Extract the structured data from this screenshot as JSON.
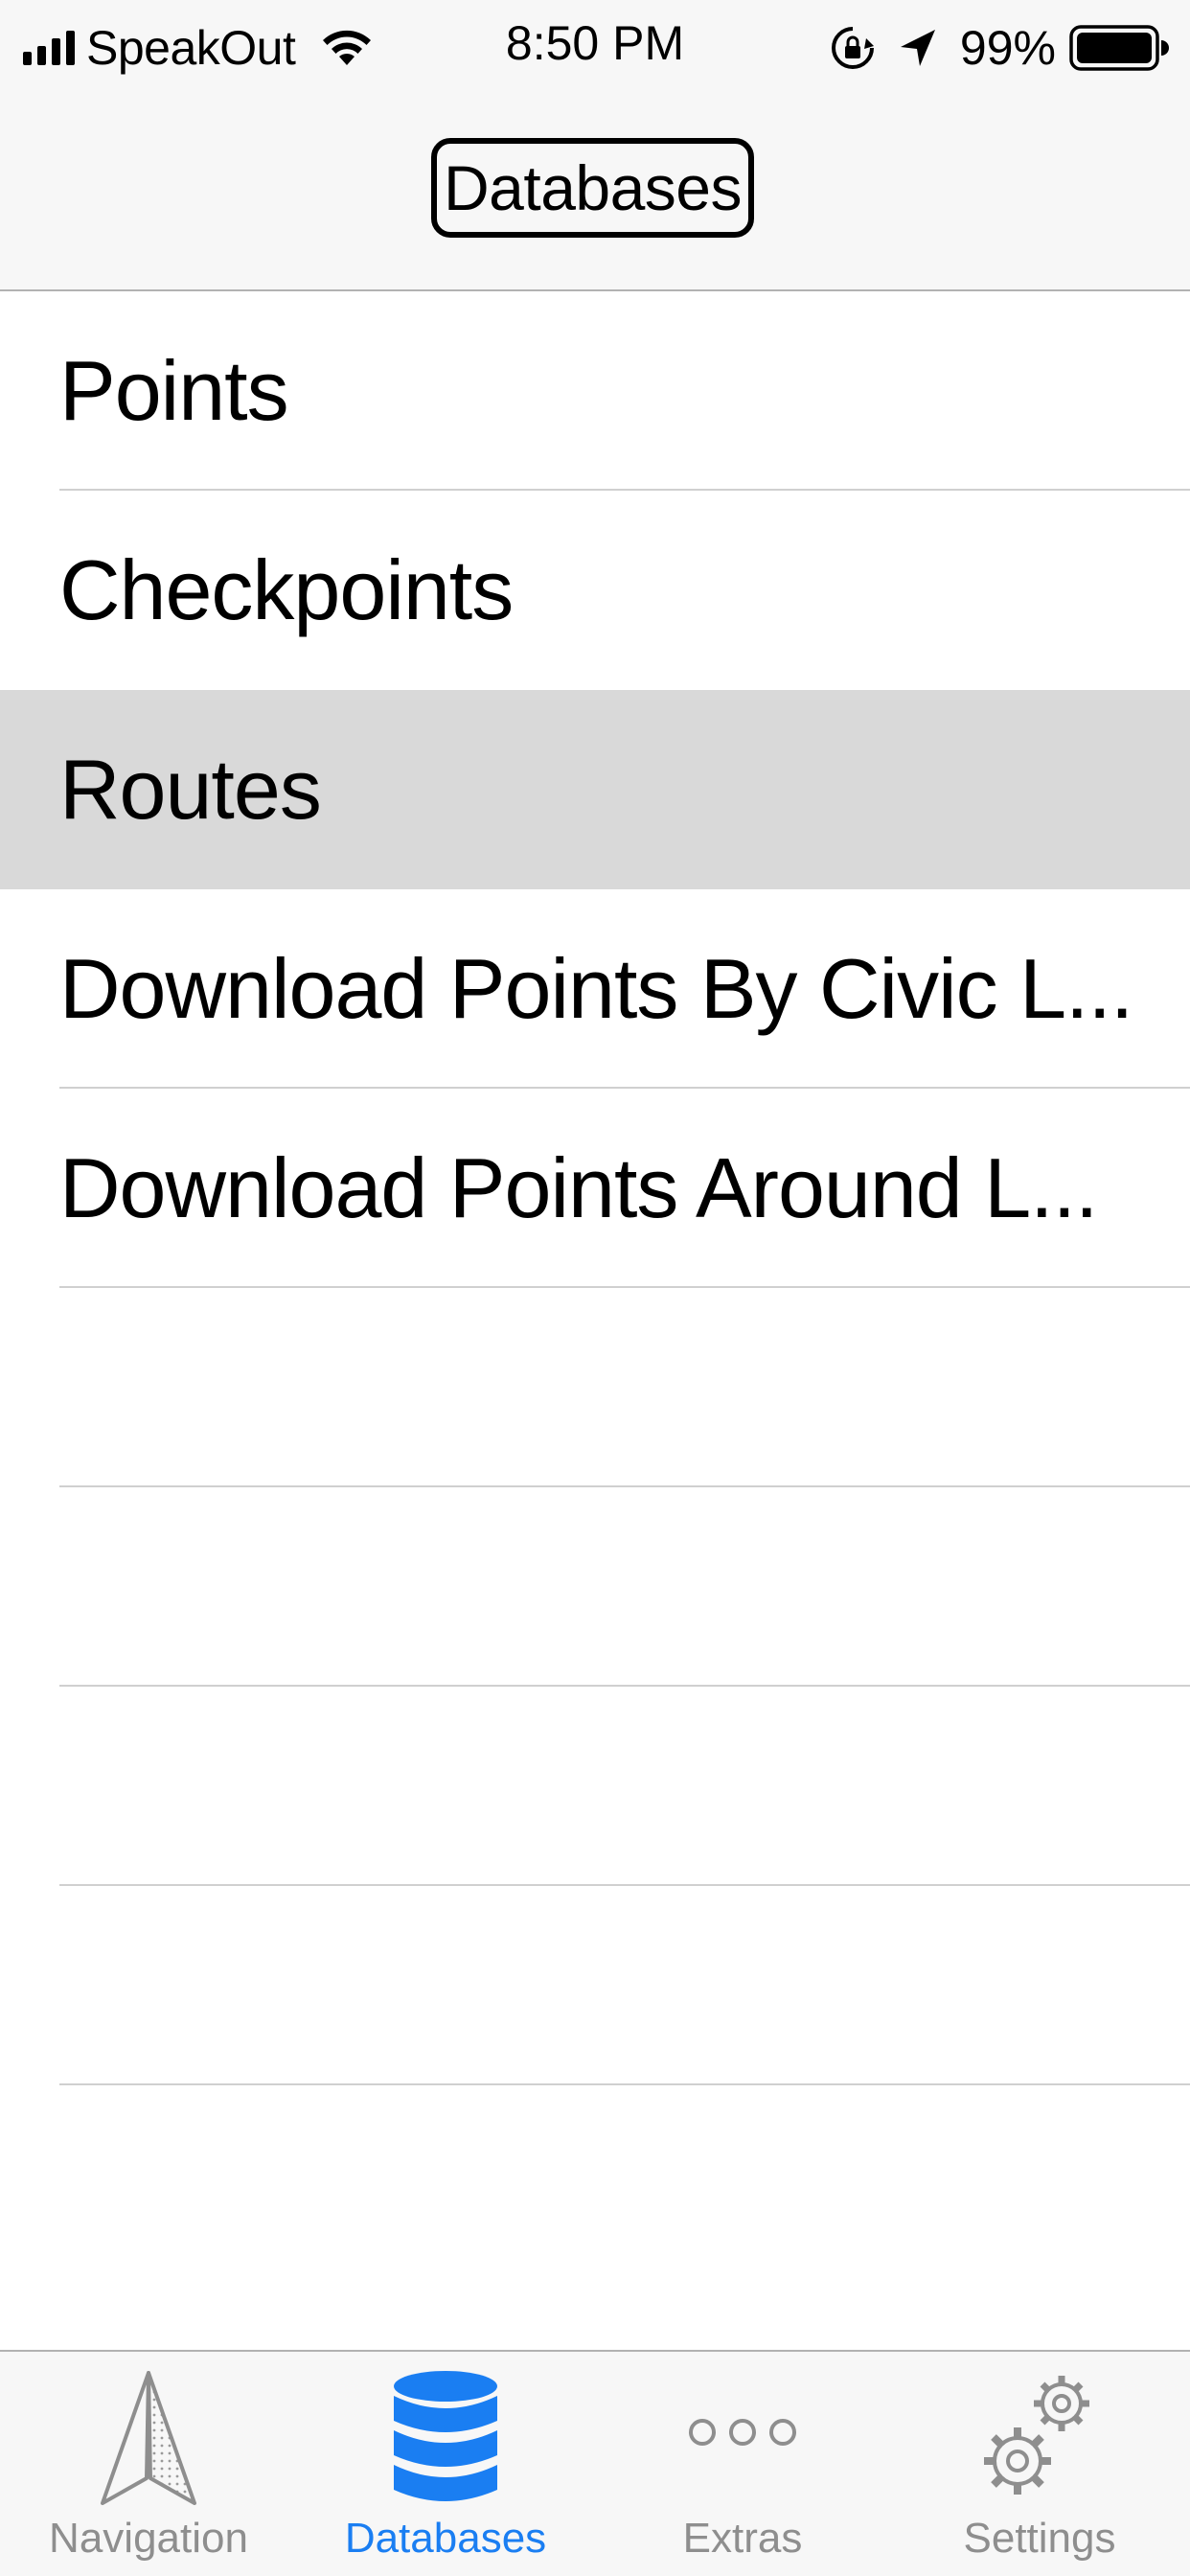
{
  "status_bar": {
    "carrier": "SpeakOut",
    "time": "8:50 PM",
    "battery_percent": "99%",
    "icons": [
      "signal-icon",
      "wifi-icon",
      "rotation-lock-icon",
      "location-arrow-icon",
      "battery-icon"
    ]
  },
  "nav": {
    "title": "Databases"
  },
  "list": {
    "items": [
      {
        "label": "Points"
      },
      {
        "label": "Checkpoints"
      },
      {
        "label": "Routes",
        "selected": true
      },
      {
        "label": "Download Points By Civic L..."
      },
      {
        "label": "Download Points Around L..."
      },
      {
        "label": ""
      },
      {
        "label": ""
      },
      {
        "label": ""
      },
      {
        "label": ""
      },
      {
        "label": ""
      }
    ]
  },
  "tab_bar": {
    "tabs": [
      {
        "label": "Navigation",
        "icon": "navigation-arrow-icon"
      },
      {
        "label": "Databases",
        "icon": "database-icon",
        "active": true
      },
      {
        "label": "Extras",
        "icon": "more-dots-icon"
      },
      {
        "label": "Settings",
        "icon": "gears-icon"
      }
    ],
    "active_color": "#1a7ef2",
    "inactive_color": "#8e8e8e"
  }
}
